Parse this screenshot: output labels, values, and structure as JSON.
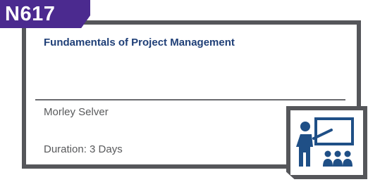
{
  "course": {
    "code": "N617",
    "title": "Fundamentals of Project Management",
    "instructor": "Morley Selver",
    "duration": "Duration: 3 Days"
  },
  "icons": {
    "course_type": "classroom-presentation-icon"
  },
  "colors": {
    "tab_purple": "#4b2a8f",
    "title_blue": "#1f3f77",
    "frame_gray": "#55565a",
    "text_gray": "#58595b",
    "icon_blue": "#1f4f86"
  }
}
